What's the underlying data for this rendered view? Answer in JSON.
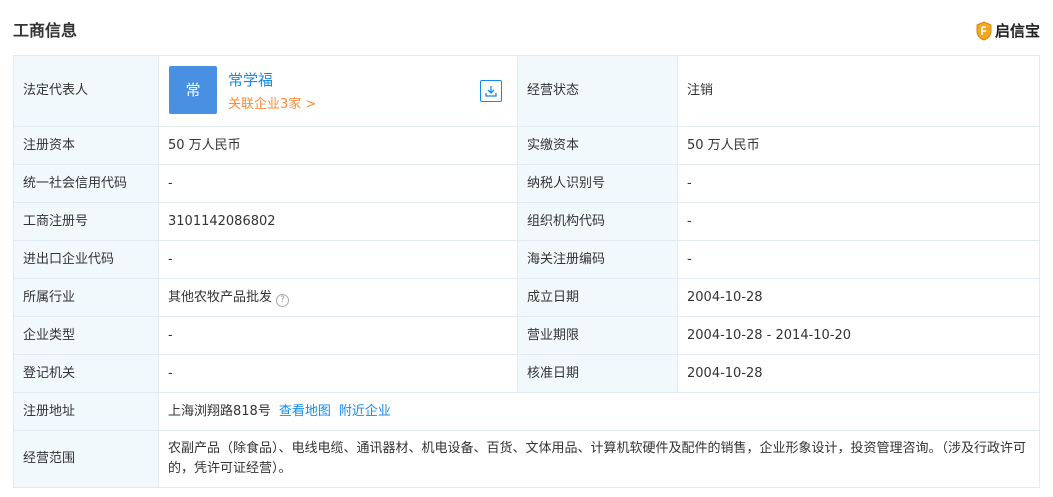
{
  "section_title": "工商信息",
  "brand": {
    "name": "启信宝",
    "icon": "shield-logo-icon",
    "accent": "#f5a623"
  },
  "colors": {
    "label_bg": "#f2f9fc",
    "border": "#e4eaf2",
    "link": "#128bed",
    "related": "#fd8a3c",
    "avatar_bg": "#4a90e2"
  },
  "legal_rep": {
    "label": "法定代表人",
    "avatar_char": "常",
    "name": "常学福",
    "related": "关联企业3家 >",
    "download_icon": "download-icon"
  },
  "rows": {
    "status": {
      "label": "经营状态",
      "value": "注销"
    },
    "reg_capital": {
      "label": "注册资本",
      "value": "50 万人民币"
    },
    "paid_capital": {
      "label": "实缴资本",
      "value": "50 万人民币"
    },
    "credit_code": {
      "label": "统一社会信用代码",
      "value": "-"
    },
    "taxpayer_id": {
      "label": "纳税人识别号",
      "value": "-"
    },
    "reg_no": {
      "label": "工商注册号",
      "value": "3101142086802"
    },
    "org_code": {
      "label": "组织机构代码",
      "value": "-"
    },
    "import_export_code": {
      "label": "进出口企业代码",
      "value": "-"
    },
    "customs_code": {
      "label": "海关注册编码",
      "value": "-"
    },
    "industry": {
      "label": "所属行业",
      "value": "其他农牧产品批发",
      "help_icon": "question-circle-icon"
    },
    "founded": {
      "label": "成立日期",
      "value": "2004-10-28"
    },
    "company_type": {
      "label": "企业类型",
      "value": "-"
    },
    "business_term": {
      "label": "营业期限",
      "value": "2004-10-28 - 2014-10-20"
    },
    "authority": {
      "label": "登记机关",
      "value": "-"
    },
    "approval_date": {
      "label": "核准日期",
      "value": "2004-10-28"
    },
    "address": {
      "label": "注册地址",
      "value": "上海浏翔路818号",
      "map_link": "查看地图",
      "nearby_link": "附近企业"
    },
    "scope": {
      "label": "经营范围",
      "value": "农副产品（除食品）、电线电缆、通讯器材、机电设备、百货、文体用品、计算机软硬件及配件的销售，企业形象设计，投资管理咨询。（涉及行政许可的，凭许可证经营）。"
    }
  }
}
